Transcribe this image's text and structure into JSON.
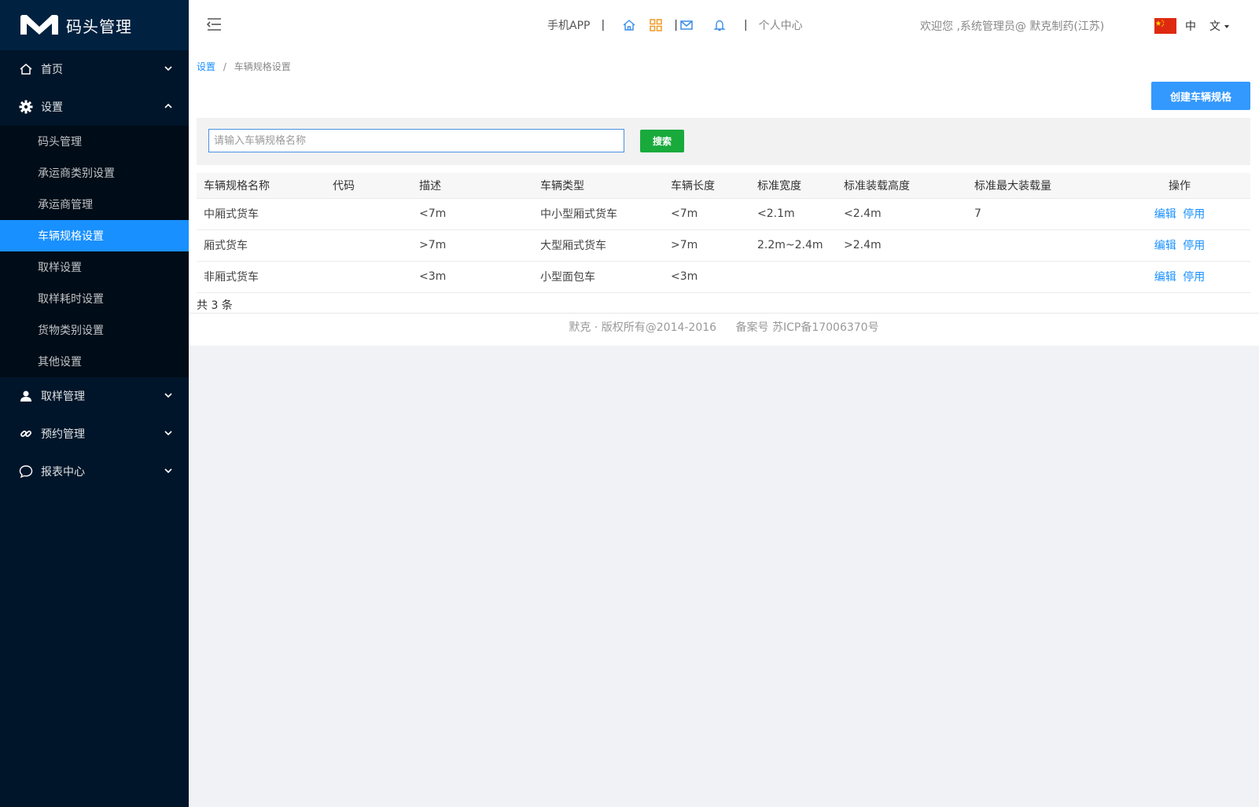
{
  "app": {
    "title": "码头管理"
  },
  "sidebar": {
    "menu": [
      {
        "label": "首页",
        "icon": "home-icon",
        "expanded": false
      },
      {
        "label": "设置",
        "icon": "gear-icon",
        "expanded": true,
        "children": [
          "码头管理",
          "承运商类别设置",
          "承运商管理",
          "车辆规格设置",
          "取样设置",
          "取样耗时设置",
          "货物类别设置",
          "其他设置"
        ],
        "active_child": "车辆规格设置"
      },
      {
        "label": "取样管理",
        "icon": "user-icon",
        "expanded": false
      },
      {
        "label": "预约管理",
        "icon": "link-icon",
        "expanded": false
      },
      {
        "label": "报表中心",
        "icon": "chat-bubble-icon",
        "expanded": false
      }
    ]
  },
  "header": {
    "mobile_app": "手机APP",
    "separator": "|",
    "personal_center": "个人中心",
    "welcome": "欢迎您 ,系统管理员@ 默克制药(江苏)",
    "lang_current": "中",
    "lang_switch": "文"
  },
  "breadcrumb": {
    "root": "设置",
    "sep": "/",
    "current": "车辆规格设置"
  },
  "toolbar": {
    "create_label": "创建车辆规格"
  },
  "search": {
    "placeholder": "请输入车辆规格名称",
    "button_label": "搜索"
  },
  "table": {
    "headers": [
      "车辆规格名称",
      "代码",
      "描述",
      "车辆类型",
      "车辆长度",
      "标准宽度",
      "标准装载高度",
      "标准最大装载量",
      "操作"
    ],
    "rows": [
      [
        "中厢式货车",
        "",
        "<7m",
        "中小型厢式货车",
        "<7m",
        "<2.1m",
        "<2.4m",
        "7"
      ],
      [
        "厢式货车",
        "",
        ">7m",
        "大型厢式货车",
        ">7m",
        "2.2m~2.4m",
        ">2.4m",
        ""
      ],
      [
        "非厢式货车",
        "",
        "<3m",
        "小型面包车",
        "<3m",
        "",
        "",
        ""
      ]
    ],
    "op_edit": "编辑",
    "op_disable": "停用"
  },
  "summary": {
    "total": "共 3 条"
  },
  "footer": {
    "copyright": "默克 · 版权所有@2014-2016",
    "icp": "备案号 苏ICP备17006370号"
  },
  "colors": {
    "sidebar_bg": "#001529",
    "active": "#1890ff",
    "search_btn": "#19aa3c",
    "create_btn": "#3399ff"
  }
}
